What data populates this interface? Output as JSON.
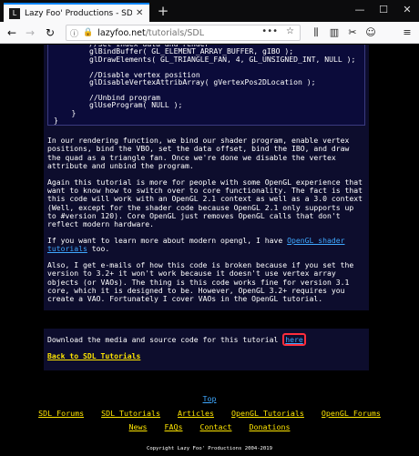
{
  "browser": {
    "tab_title": "Lazy Foo' Productions - SDL and M",
    "new_tab": "+",
    "url_host": "lazyfoo.net",
    "url_path": "/tutorials/SDL",
    "window_minimize": "—",
    "window_maximize": "☐",
    "window_close": "✕"
  },
  "code": {
    "lines": [
      "        //Set index data and render",
      "        glBindBuffer( GL_ELEMENT_ARRAY_BUFFER, gIBO );",
      "        glDrawElements( GL_TRIANGLE_FAN, 4, GL_UNSIGNED_INT, NULL );",
      "",
      "        //Disable vertex position",
      "        glDisableVertexAttribArray( gVertexPos2DLocation );",
      "",
      "        //Unbind program",
      "        glUseProgram( NULL );",
      "    }",
      "}"
    ]
  },
  "article": {
    "p1": "In our rendering function, we bind our shader program, enable vertex positions, bind the VBO, set the data offset, bind the IBO, and draw the quad as a triangle fan. Once we're done we disable the vertex attribute and unbind the program.",
    "p2": "Again this tutorial is more for people with some OpenGL experience that want to know how to switch over to core functionality. The fact is that this code will work with an OpenGL 2.1 context as well as a 3.0 context (Well, except for the shader code because OpenGL 2.1 only supports up to #version 120). Core OpenGL just removes OpenGL calls that don't reflect modern hardware.",
    "p3_before": "If you want to learn more about modern opengl, I have ",
    "p3_link": "OpenGL shader tutorials",
    "p3_after": " too.",
    "p4": "Also, I get e-mails of how this code is broken because if you set the version to 3.2+ it won't work because it doesn't use vertex array objects (or VAOs). The thing is this code works fine for version 3.1 core, which it is designed to be. However, OpenGL 3.2+ requires you create a VAO. Fortunately I cover VAOs in the OpenGL tutorial."
  },
  "download": {
    "text": "Download the media and source code for this tutorial ",
    "here": "here",
    "back": "Back to SDL Tutorials"
  },
  "footer": {
    "top": "Top",
    "row1": [
      "SDL Forums",
      "SDL Tutorials",
      "Articles",
      "OpenGL Tutorials",
      "OpenGL Forums"
    ],
    "row2": [
      "News",
      "FAQs",
      "Contact",
      "Donations"
    ],
    "copyright": "Copyright Lazy Foo' Productions 2004-2019"
  }
}
